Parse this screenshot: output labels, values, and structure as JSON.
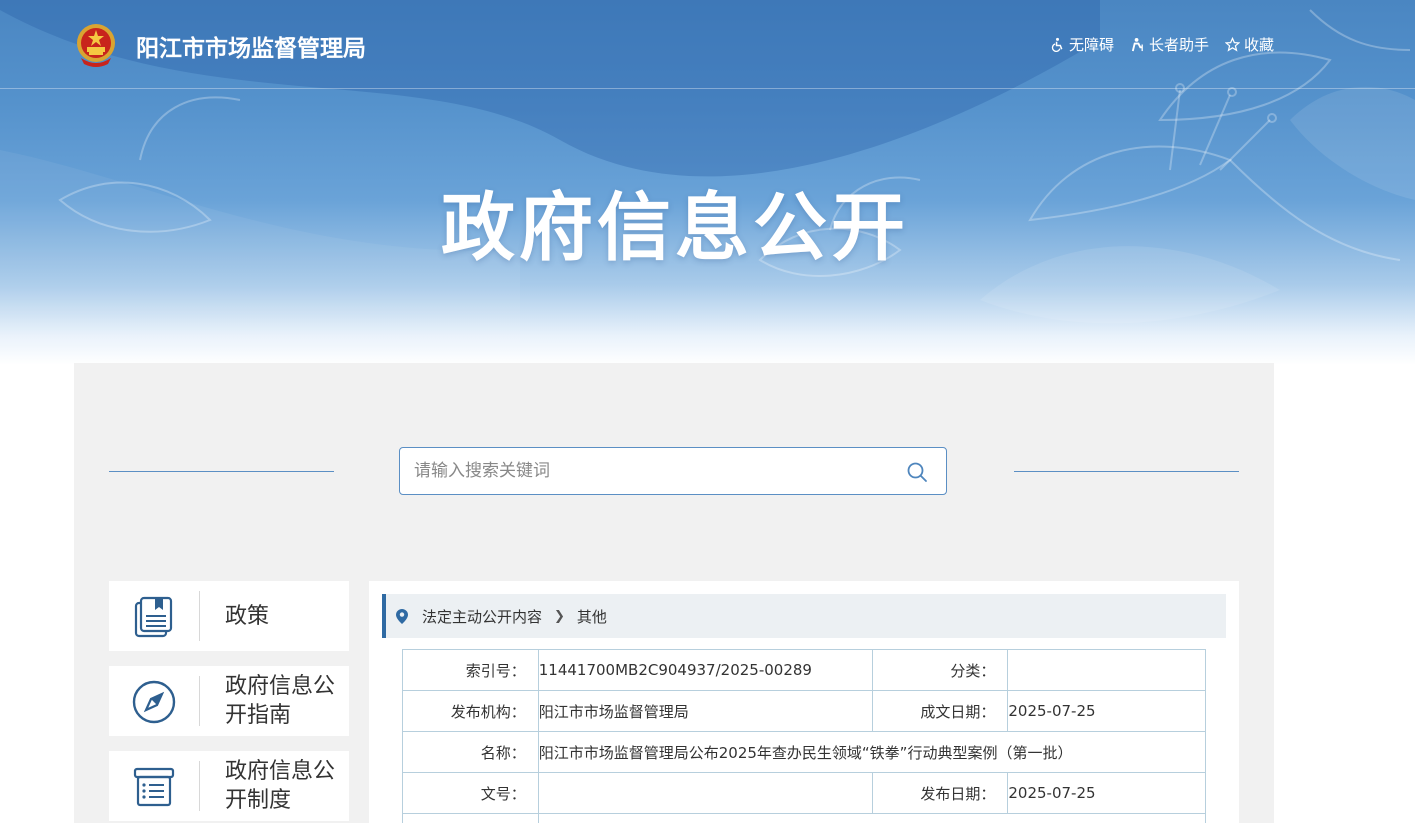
{
  "header": {
    "site_name": "阳江市市场监督管理局",
    "links": [
      {
        "label": "无障碍",
        "icon": "wheelchair-icon"
      },
      {
        "label": "长者助手",
        "icon": "elder-helper-icon"
      },
      {
        "label": "收藏",
        "icon": "star-icon"
      }
    ]
  },
  "banner": {
    "title": "政府信息公开"
  },
  "search": {
    "placeholder": "请输入搜索关键词"
  },
  "sidebar": {
    "items": [
      {
        "label": "政策",
        "icon": "policy-book-icon"
      },
      {
        "label": "政府信息公开指南",
        "icon": "compass-icon"
      },
      {
        "label": "政府信息公开制度",
        "icon": "document-list-icon"
      }
    ]
  },
  "breadcrumb": {
    "items": [
      "法定主动公开内容",
      "其他"
    ]
  },
  "info": {
    "index_label": "索引号：",
    "index_value": "11441700MB2C904937/2025-00289",
    "category_label": "分类：",
    "category_value": "",
    "publisher_label": "发布机构：",
    "publisher_value": "阳江市市场监督管理局",
    "written_date_label": "成文日期：",
    "written_date_value": "2025-07-25",
    "name_label": "名称：",
    "name_value": "阳江市市场监督管理局公布2025年查办民生领域“铁拳”行动典型案例（第一批）",
    "doc_no_label": "文号：",
    "doc_no_value": "",
    "publish_date_label": "发布日期：",
    "publish_date_value": "2025-07-25"
  },
  "colors": {
    "banner_blue": "#4a86c2",
    "accent_blue": "#2f6aa3",
    "panel_gray": "#f1f1f1",
    "table_border": "#b7cfdd"
  }
}
